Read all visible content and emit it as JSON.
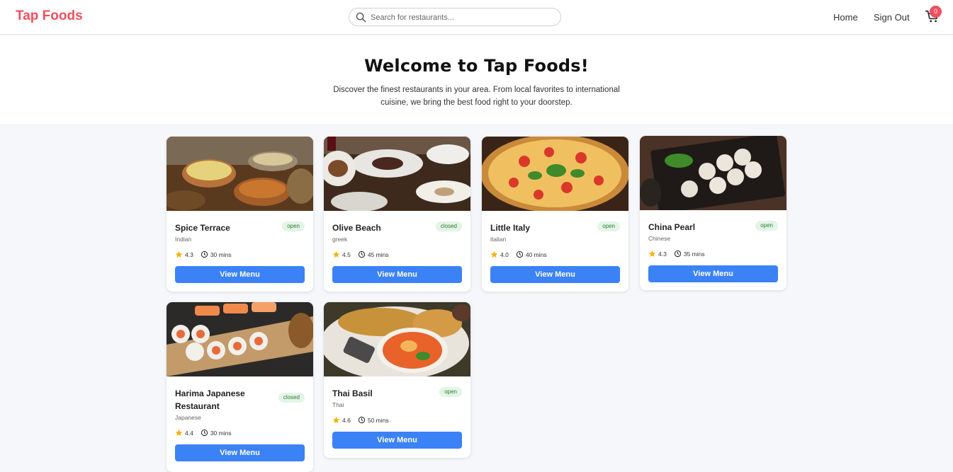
{
  "nav": {
    "brand": "Tap Foods",
    "search_placeholder": "Search for restaurants...",
    "home": "Home",
    "sign_out": "Sign Out",
    "cart_count": "0"
  },
  "hero": {
    "title": "Welcome to Tap Foods!",
    "subtitle": "Discover the finest restaurants in your area. From local favorites to international cuisine, we bring the best food right to your doorstep."
  },
  "restaurants": [
    {
      "name": "Spice Terrace",
      "cuisine": "Indian",
      "status": "open",
      "rating": "4.3",
      "time": "30 mins",
      "button": "View Menu"
    },
    {
      "name": "Olive Beach",
      "cuisine": "greek",
      "status": "closed",
      "rating": "4.5",
      "time": "45 mins",
      "button": "View Menu"
    },
    {
      "name": "Little Italy",
      "cuisine": "italian",
      "status": "open",
      "rating": "4.0",
      "time": "40 mins",
      "button": "View Menu"
    },
    {
      "name": "China Pearl",
      "cuisine": "Chinese",
      "status": "open",
      "rating": "4.3",
      "time": "35 mins",
      "button": "View Menu"
    },
    {
      "name": "Harima Japanese Restaurant",
      "cuisine": "Japanese",
      "status": "closed",
      "rating": "4.4",
      "time": "30 mins",
      "button": "View Menu"
    },
    {
      "name": "Thai Basil",
      "cuisine": "Thai",
      "status": "open",
      "rating": "4.6",
      "time": "50 mins",
      "button": "View Menu"
    }
  ],
  "colors": {
    "brand": "#ef4f5f",
    "button": "#3b82f6",
    "badge_bg": "#e3f5e6",
    "badge_text": "#2e7d32",
    "star": "#f5b301"
  }
}
